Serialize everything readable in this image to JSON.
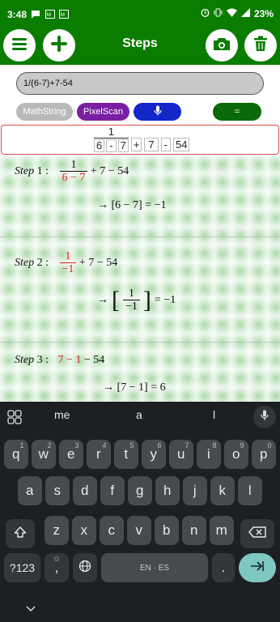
{
  "status_bar": {
    "time": "3:48",
    "battery": "23%"
  },
  "app_bar": {
    "title": "Steps",
    "menu_icon": "hamburger-menu-icon",
    "add_icon": "plus-icon",
    "camera_icon": "camera-icon",
    "delete_icon": "trash-icon"
  },
  "input": {
    "value": "1/(6-7)+7-54"
  },
  "chips": {
    "mathstring": "MathString",
    "pixelscan": "PixelScan",
    "mic_icon": "microphone-icon",
    "equals": "="
  },
  "display": {
    "num": "1",
    "den_a": "6",
    "minus": "-",
    "den_b": "7",
    "plus": "+",
    "seven": "7",
    "minus2": "-",
    "fiftyfour": "54"
  },
  "steps": [
    {
      "label": "Step",
      "index": "1",
      "expr_num": "1",
      "expr_den": "6 − 7",
      "expr_rest": "+ 7 − 54",
      "result": "→ [6 − 7] = −1"
    },
    {
      "label": "Step",
      "index": "2",
      "expr_num": "1",
      "expr_den": "−1",
      "expr_rest": "+ 7 − 54",
      "result_arrow": "→",
      "result_num": "1",
      "result_den": "−1",
      "result_tail": "= −1"
    },
    {
      "label": "Step",
      "index": "3",
      "expr_red": "7 − 1",
      "expr_rest": "− 54",
      "result": "→ [7 − 1] = 6"
    }
  ],
  "keyboard": {
    "suggestions": [
      "me",
      "a",
      "l"
    ],
    "row1": [
      "q",
      "w",
      "e",
      "r",
      "t",
      "y",
      "u",
      "i",
      "o",
      "p"
    ],
    "row1_sup": [
      "1",
      "2",
      "3",
      "4",
      "5",
      "6",
      "7",
      "8",
      "9",
      "0"
    ],
    "row2": [
      "a",
      "s",
      "d",
      "f",
      "g",
      "h",
      "j",
      "k",
      "l"
    ],
    "row3": [
      "z",
      "x",
      "c",
      "v",
      "b",
      "n",
      "m"
    ],
    "sym": "?123",
    "comma": ",",
    "space": "EN · ES",
    "period": "."
  },
  "colors": {
    "brand_green": "#0a7d00",
    "accent_red": "#e02020",
    "pixelscan_purple": "#7a1fa2",
    "mic_blue": "#1326c8",
    "equals_green": "#0a6a0a"
  }
}
